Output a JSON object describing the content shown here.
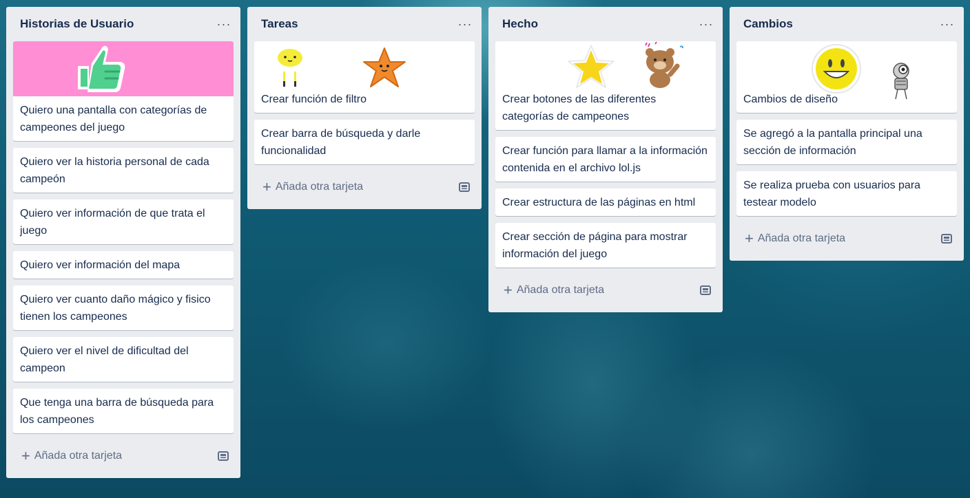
{
  "lists": [
    {
      "title": "Historias de Usuario",
      "menu": "···",
      "cards": [
        {
          "text": "Quiero una pantalla con categorías de campeones del juego",
          "cover_color": "#ff8ed4",
          "cover_icon": "thumbs-up-icon"
        },
        {
          "text": "Quiero ver la historia personal de cada campeón"
        },
        {
          "text": "Quiero ver información de que trata el juego"
        },
        {
          "text": "Quiero ver información del mapa"
        },
        {
          "text": "Quiero ver cuanto daño mágico y fisico tienen los campeones"
        },
        {
          "text": "Quiero ver el nivel de dificultad del campeon"
        },
        {
          "text": "Que tenga una barra de búsqueda para los campeones"
        }
      ],
      "add_label": "Añada otra tarjeta"
    },
    {
      "title": "Tareas",
      "menu": "···",
      "cards": [
        {
          "text": "Crear función de filtro",
          "stickers": [
            "jellyfish-sticker",
            "starfish-sticker"
          ]
        },
        {
          "text": "Crear barra de búsqueda y darle funcionalidad"
        }
      ],
      "add_label": "Añada otra tarjeta"
    },
    {
      "title": "Hecho",
      "menu": "···",
      "cards": [
        {
          "text": "Crear botones de las diferentes categorías de campeones",
          "stickers": [
            "star-sticker",
            "bear-sticker"
          ]
        },
        {
          "text": "Crear función para llamar a la información contenida en el archivo lol.js"
        },
        {
          "text": "Crear estructura de las páginas en html"
        },
        {
          "text": "Crear sección de página para mostrar información del juego"
        }
      ],
      "add_label": "Añada otra tarjeta"
    },
    {
      "title": "Cambios",
      "menu": "···",
      "cards": [
        {
          "text": "Cambios de diseño",
          "stickers": [
            "smiley-sticker",
            "robot-sticker"
          ]
        },
        {
          "text": "Se agregó a la pantalla principal una sección de información"
        },
        {
          "text": "Se realiza prueba con usuarios para testear modelo"
        }
      ],
      "add_label": "Añada otra tarjeta"
    }
  ],
  "colors": {
    "list_bg": "#ebecf0",
    "text": "#172b4d",
    "muted": "#5e6c84"
  }
}
